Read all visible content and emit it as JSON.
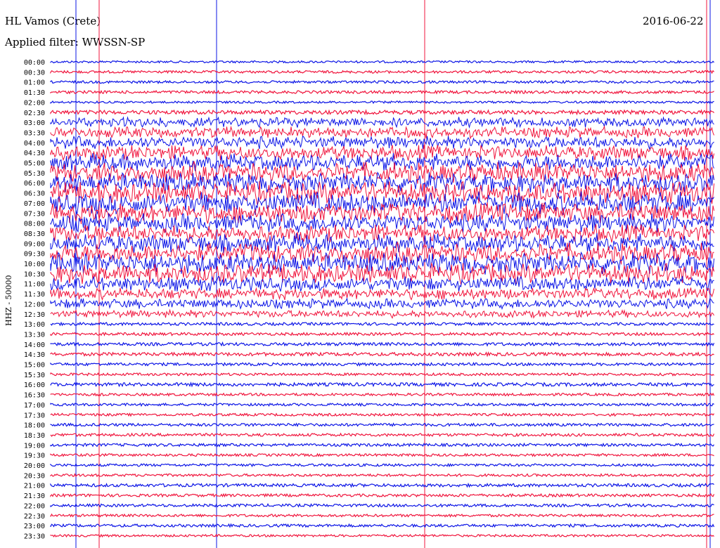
{
  "header": {
    "station": "HL Vamos (Crete)",
    "date": "2016-06-22",
    "filter": "Applied filter: WWSSN-SP"
  },
  "chart_data": {
    "type": "line",
    "title": "HL Vamos (Crete)",
    "date": "2016-06-22",
    "filter": "WWSSN-SP",
    "ylabel": "HHZ - 50000",
    "series_colors": {
      "even_rows": "#0b14e6",
      "odd_rows": "#f0143c"
    },
    "rows": [
      {
        "t": "00:00",
        "amp": 1.5
      },
      {
        "t": "00:30",
        "amp": 1.8
      },
      {
        "t": "01:00",
        "amp": 1.8
      },
      {
        "t": "01:30",
        "amp": 2.0
      },
      {
        "t": "02:00",
        "amp": 1.5
      },
      {
        "t": "02:30",
        "amp": 2.8
      },
      {
        "t": "03:00",
        "amp": 8
      },
      {
        "t": "03:30",
        "amp": 9
      },
      {
        "t": "04:00",
        "amp": 10
      },
      {
        "t": "04:30",
        "amp": 12
      },
      {
        "t": "05:00",
        "amp": 14
      },
      {
        "t": "05:30",
        "amp": 16
      },
      {
        "t": "06:00",
        "amp": 16
      },
      {
        "t": "06:30",
        "amp": 18
      },
      {
        "t": "07:00",
        "amp": 18
      },
      {
        "t": "07:30",
        "amp": 16
      },
      {
        "t": "08:00",
        "amp": 15
      },
      {
        "t": "08:30",
        "amp": 14
      },
      {
        "t": "09:00",
        "amp": 15
      },
      {
        "t": "09:30",
        "amp": 16
      },
      {
        "t": "10:00",
        "amp": 17
      },
      {
        "t": "10:30",
        "amp": 16
      },
      {
        "t": "11:00",
        "amp": 12
      },
      {
        "t": "11:30",
        "amp": 9
      },
      {
        "t": "12:00",
        "amp": 8
      },
      {
        "t": "12:30",
        "amp": 6
      },
      {
        "t": "13:00",
        "amp": 2.0
      },
      {
        "t": "13:30",
        "amp": 2.0
      },
      {
        "t": "14:00",
        "amp": 2.2
      },
      {
        "t": "14:30",
        "amp": 2.4
      },
      {
        "t": "15:00",
        "amp": 2.0
      },
      {
        "t": "15:30",
        "amp": 1.8
      },
      {
        "t": "16:00",
        "amp": 2.4
      },
      {
        "t": "16:30",
        "amp": 1.8
      },
      {
        "t": "17:00",
        "amp": 1.8
      },
      {
        "t": "17:30",
        "amp": 1.8
      },
      {
        "t": "18:00",
        "amp": 2.0
      },
      {
        "t": "18:30",
        "amp": 2.0
      },
      {
        "t": "19:00",
        "amp": 2.0
      },
      {
        "t": "19:30",
        "amp": 1.8
      },
      {
        "t": "20:00",
        "amp": 1.8
      },
      {
        "t": "20:30",
        "amp": 1.8
      },
      {
        "t": "21:00",
        "amp": 2.2
      },
      {
        "t": "21:30",
        "amp": 2.0
      },
      {
        "t": "22:00",
        "amp": 2.0
      },
      {
        "t": "22:30",
        "amp": 1.8
      },
      {
        "t": "23:00",
        "amp": 2.0
      },
      {
        "t": "23:30",
        "amp": 1.6
      }
    ]
  }
}
